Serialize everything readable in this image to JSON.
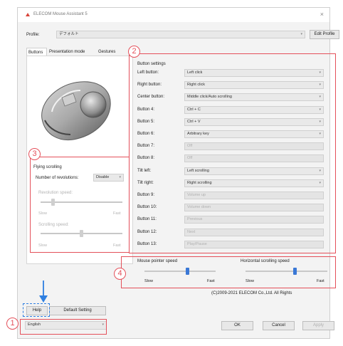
{
  "window": {
    "title": "ELECOM Mouse Assistant 5",
    "close_glyph": "×"
  },
  "profile": {
    "label": "Profile:",
    "value": "デフォルト",
    "edit_label": "Edit Profile"
  },
  "tabs": [
    {
      "label": "Buttons"
    },
    {
      "label": "Presentation mode"
    },
    {
      "label": "Gestures"
    }
  ],
  "flying": {
    "title": "Flying scrolling",
    "revolutions_label": "Number of revolutions:",
    "revolutions_value": "Disable",
    "revolution_speed_label": "Revolution speed:",
    "scrolling_speed_label": "Scrolling speed:",
    "slow": "Slow",
    "fast": "Fast",
    "revolution_speed_level": 0.15,
    "scrolling_speed_level": 0.5
  },
  "button_settings": {
    "title": "Button settings",
    "rows": [
      {
        "label": "Left button:",
        "value": "Left click",
        "enabled": true
      },
      {
        "label": "Right button:",
        "value": "Right click",
        "enabled": true
      },
      {
        "label": "Center button:",
        "value": "Middle click/Auto scrolling",
        "enabled": true
      },
      {
        "label": "Button 4:",
        "value": "Ctrl + C",
        "enabled": true
      },
      {
        "label": "Button 5:",
        "value": "Ctrl + V",
        "enabled": true
      },
      {
        "label": "Button 6:",
        "value": "Arbitrary key",
        "enabled": true
      },
      {
        "label": "Button 7:",
        "value": "Off",
        "enabled": false
      },
      {
        "label": "Button 8:",
        "value": "Off",
        "enabled": false
      },
      {
        "label": "Tilt left:",
        "value": "Left scrolling",
        "enabled": true
      },
      {
        "label": "Tilt right:",
        "value": "Right scrolling",
        "enabled": true
      },
      {
        "label": "Button 9:",
        "value": "Volume up",
        "enabled": false
      },
      {
        "label": "Button 10:",
        "value": "Volume down",
        "enabled": false
      },
      {
        "label": "Button 11:",
        "value": "Previous",
        "enabled": false
      },
      {
        "label": "Button 12:",
        "value": "Next",
        "enabled": false
      },
      {
        "label": "Button 13:",
        "value": "Play/Pause",
        "enabled": false
      }
    ]
  },
  "speed": {
    "pointer_label": "Mouse pointer speed",
    "horizontal_label": "Horizontal scrolling speed",
    "slow": "Slow",
    "fast": "Fast",
    "pointer_level": 0.6,
    "horizontal_level": 0.6
  },
  "copyright": "(C)2009-2021 ELECOM Co.,Ltd. All Rights",
  "footer": {
    "help_label": "Help",
    "default_label": "Default Setting",
    "language_value": "English",
    "ok_label": "OK",
    "cancel_label": "Cancel",
    "apply_label": "Apply"
  },
  "annotations": {
    "one": "1",
    "two": "2",
    "three": "3",
    "four": "4"
  },
  "colors": {
    "annotation_red": "#e4505a",
    "slider_blue": "#3a78d6",
    "arrow_blue": "#2f7fe0"
  }
}
